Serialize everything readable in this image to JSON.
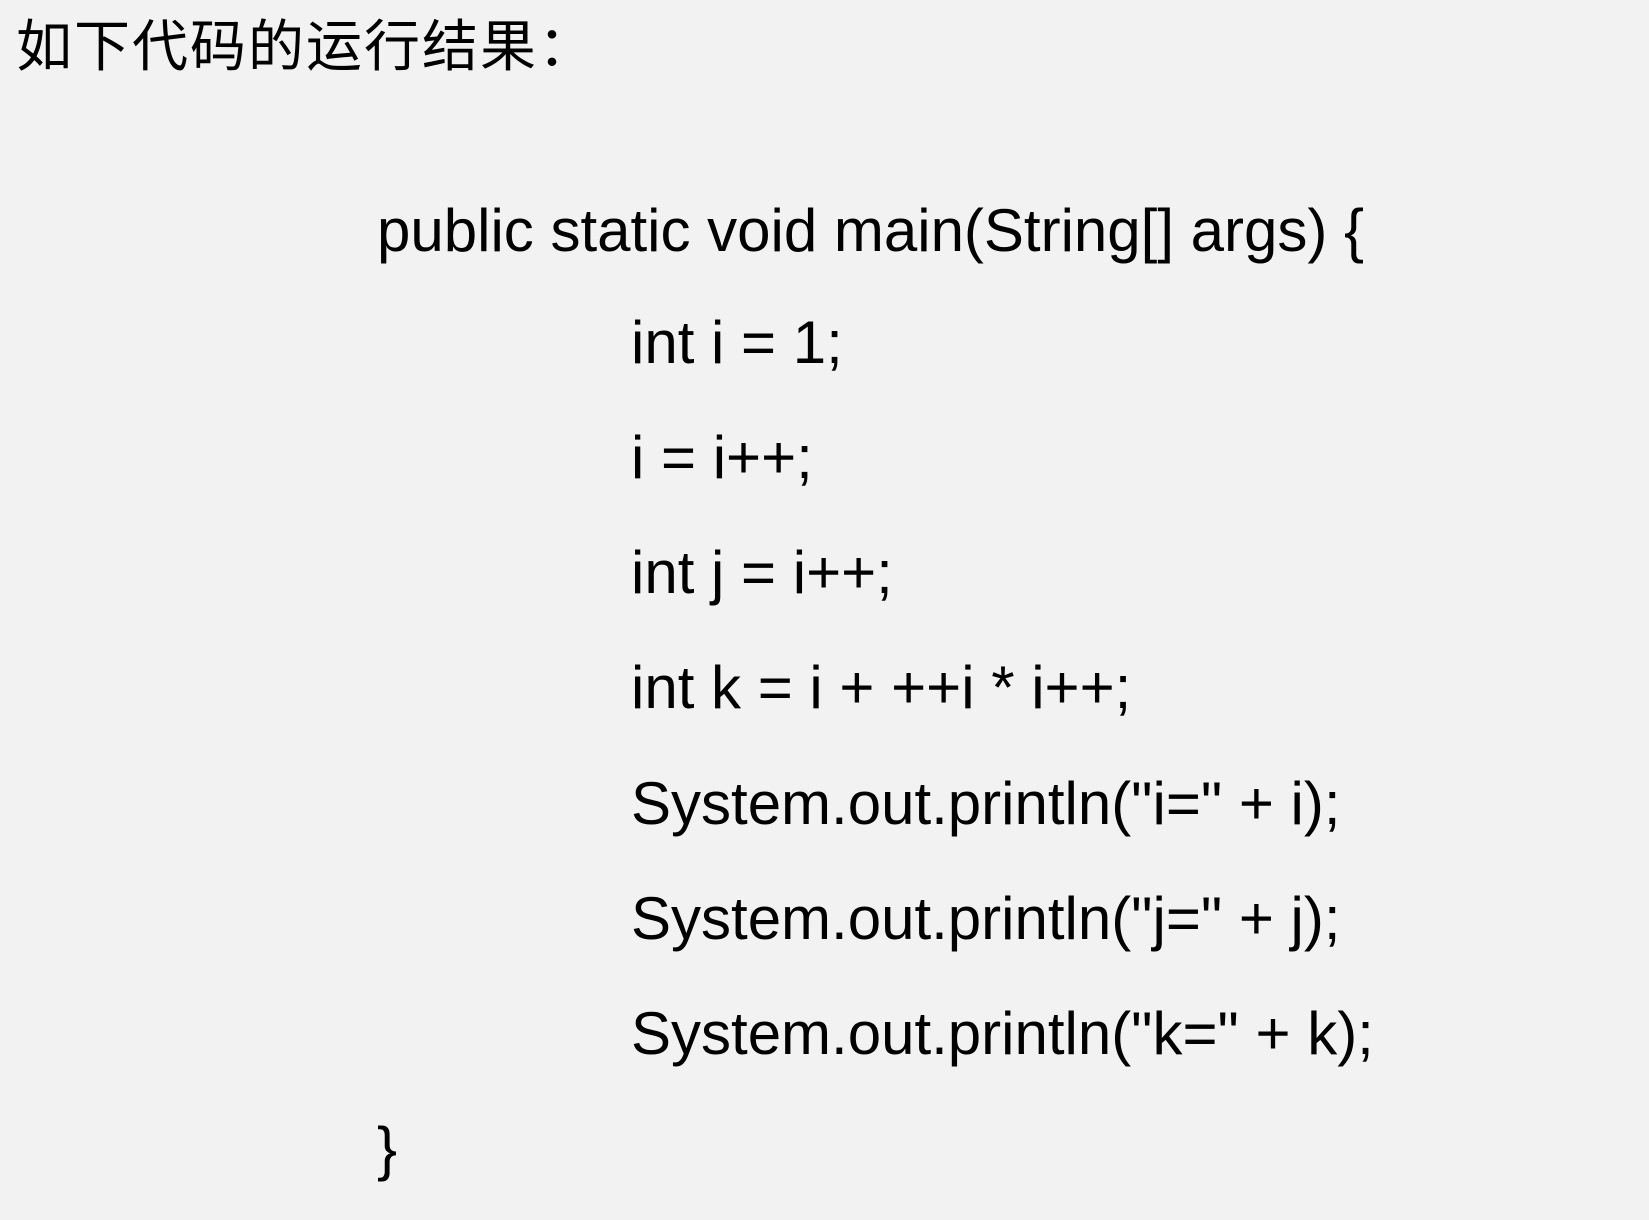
{
  "heading": "如下代码的运行结果：",
  "code": {
    "signature": "public static void main(String[] args) {",
    "body": [
      "int i = 1;",
      "i = i++;",
      "int j = i++;",
      "int k = i + ++i * i++;",
      "System.out.println(\"i=\" + i);",
      "System.out.println(\"j=\" + j);",
      "System.out.println(\"k=\" + k);"
    ],
    "closing": "}"
  }
}
